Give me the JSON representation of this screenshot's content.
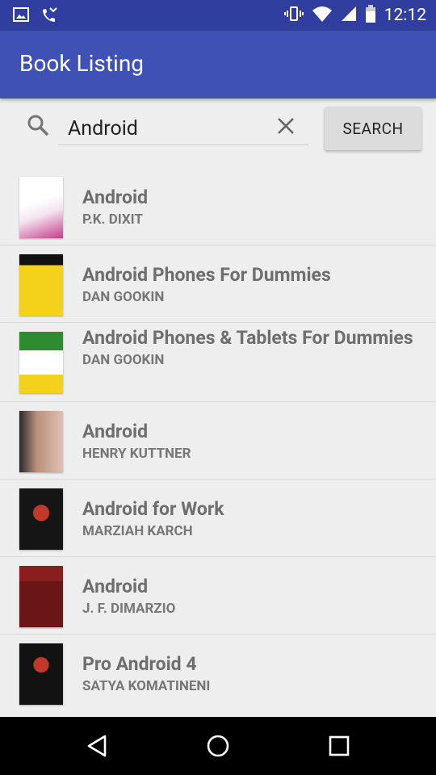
{
  "status_bar": {
    "time": "12:12"
  },
  "app_bar": {
    "title": "Book Listing"
  },
  "search": {
    "value": "Android",
    "button_label": "SEARCH"
  },
  "books": [
    {
      "title": "Android",
      "author": "P.K. DIXIT",
      "cover": "#ffffff"
    },
    {
      "title": "Android Phones For Dummies",
      "author": "DAN GOOKIN",
      "cover": "#f4d21c"
    },
    {
      "title": "Android Phones & Tablets For Dummies",
      "author": "DAN GOOKIN",
      "cover": "#2f8b2f"
    },
    {
      "title": "Android",
      "author": "HENRY KUTTNER",
      "cover": "#a08070"
    },
    {
      "title": "Android for Work",
      "author": "MARZIAH KARCH",
      "cover": "#151515"
    },
    {
      "title": "Android",
      "author": "J. F. DIMARZIO",
      "cover": "#8a1e1e"
    },
    {
      "title": "Pro Android 4",
      "author": "SATYA KOMATINENI",
      "cover": "#121212"
    }
  ],
  "colors": {
    "primary": "#3f51b5",
    "primary_dark": "#303f9f"
  }
}
